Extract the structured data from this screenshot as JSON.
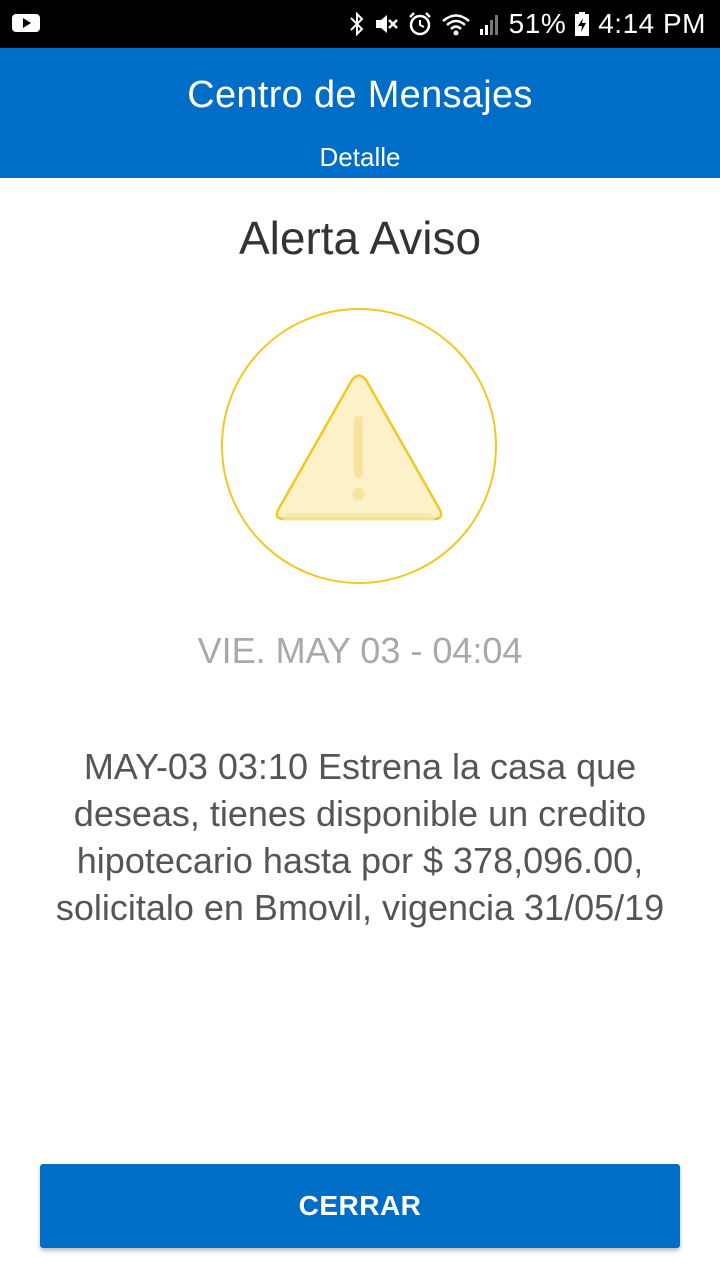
{
  "status_bar": {
    "battery_percent": "51%",
    "time": "4:14 PM",
    "icons": [
      "youtube-notification-icon",
      "bluetooth-icon",
      "mute-icon",
      "alarm-icon",
      "wifi-icon",
      "signal-icon",
      "battery-icon"
    ]
  },
  "header": {
    "title": "Centro de Mensajes",
    "subtitle": "Detalle",
    "background_color": "#006ec7"
  },
  "alert": {
    "title": "Alerta Aviso",
    "icon": "warning-icon",
    "icon_color": "#f2c71f",
    "timestamp": "VIE. MAY 03 - 04:04",
    "message": "MAY-03 03:10 Estrena la casa que deseas, tienes disponible un credito hipotecario hasta por $ 378,096.00, solicitalo en Bmovil, vigencia 31/05/19"
  },
  "actions": {
    "close_label": "CERRAR"
  }
}
